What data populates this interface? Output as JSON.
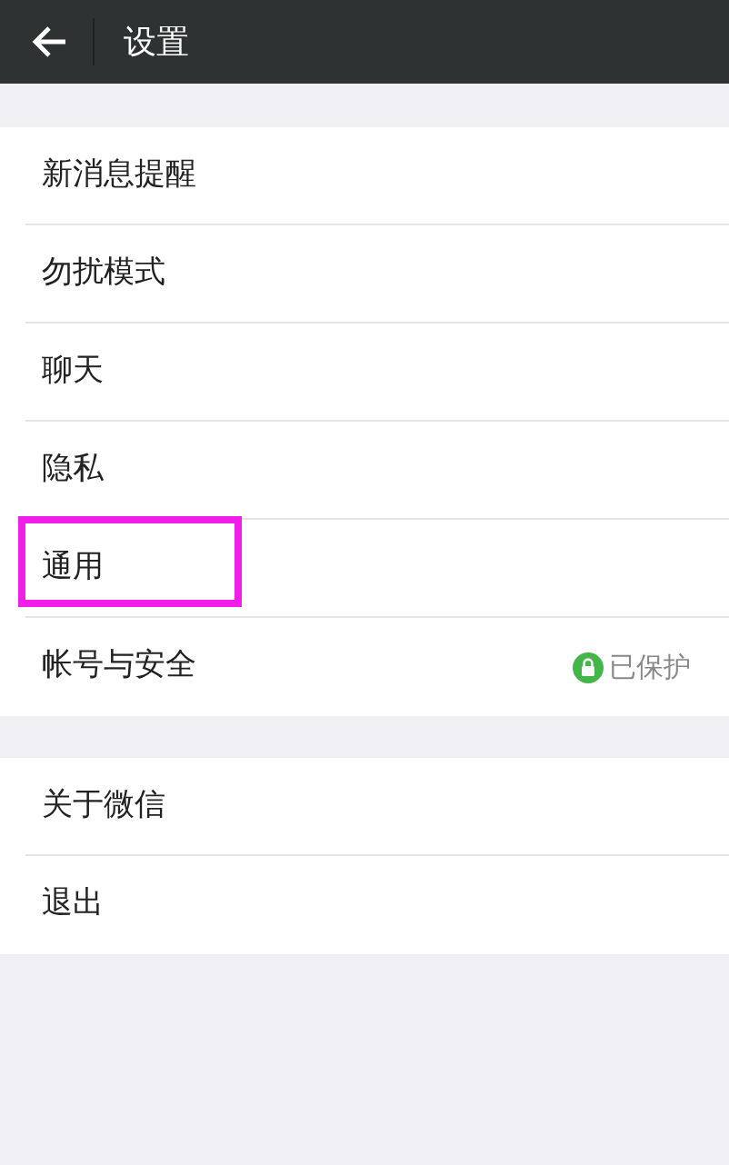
{
  "header": {
    "title": "设置"
  },
  "groups": [
    {
      "items": [
        {
          "label": "新消息提醒",
          "highlighted": false
        },
        {
          "label": "勿扰模式",
          "highlighted": false
        },
        {
          "label": "聊天",
          "highlighted": false
        },
        {
          "label": "隐私",
          "highlighted": false
        },
        {
          "label": "通用",
          "highlighted": true
        },
        {
          "label": "帐号与安全",
          "highlighted": false,
          "status": "已保护"
        }
      ]
    },
    {
      "items": [
        {
          "label": "关于微信",
          "highlighted": false
        },
        {
          "label": "退出",
          "highlighted": false
        }
      ]
    }
  ]
}
